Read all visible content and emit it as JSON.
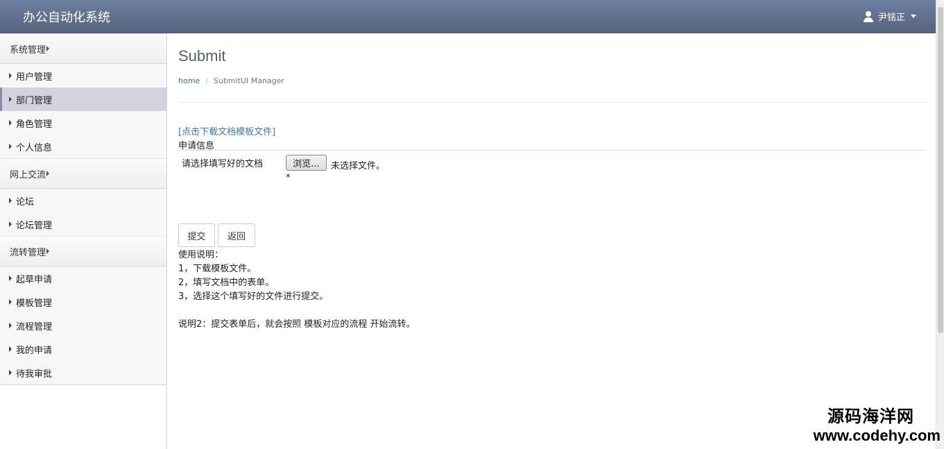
{
  "header": {
    "app_title": "办公自动化系统",
    "user_name": "尹铭正"
  },
  "sidebar": {
    "groups": [
      {
        "title": "系统管理",
        "items": [
          {
            "label": "用户管理"
          },
          {
            "label": "部门管理",
            "active": true
          },
          {
            "label": "角色管理"
          },
          {
            "label": "个人信息"
          }
        ]
      },
      {
        "title": "网上交流",
        "items": [
          {
            "label": "论坛"
          },
          {
            "label": "论坛管理"
          }
        ]
      },
      {
        "title": "流转管理",
        "items": [
          {
            "label": "起草申请"
          },
          {
            "label": "模板管理"
          },
          {
            "label": "流程管理"
          },
          {
            "label": "我的申请"
          },
          {
            "label": "待我审批"
          }
        ]
      }
    ]
  },
  "main": {
    "title": "Submit",
    "breadcrumb": {
      "home": "home",
      "current": "SubmitUI Manager"
    },
    "download_link": "[点击下载文档模板文件]",
    "section_label": "申请信息",
    "file_field": {
      "label": "请选择填写好的文档",
      "browse_label": "浏览...",
      "status": "未选择文件。",
      "required_mark": "*"
    },
    "buttons": {
      "submit": "提交",
      "back": "返回"
    },
    "instructions": {
      "title": "使用说明：",
      "steps": [
        "1，下载模板文件。",
        "2，填写文档中的表单。",
        "3，选择这个填写好的文件进行提交。"
      ],
      "note": "说明2：提交表单后，就会按照 模板对应的流程 开始流转。"
    }
  },
  "watermark": {
    "line1": "源码海洋网",
    "line2": "www.codehy.com"
  },
  "colors": {
    "header_top": "#6f7fa0",
    "header_bottom": "#56647f",
    "active_item": "#d4d3dd",
    "link": "#3a78b5"
  }
}
